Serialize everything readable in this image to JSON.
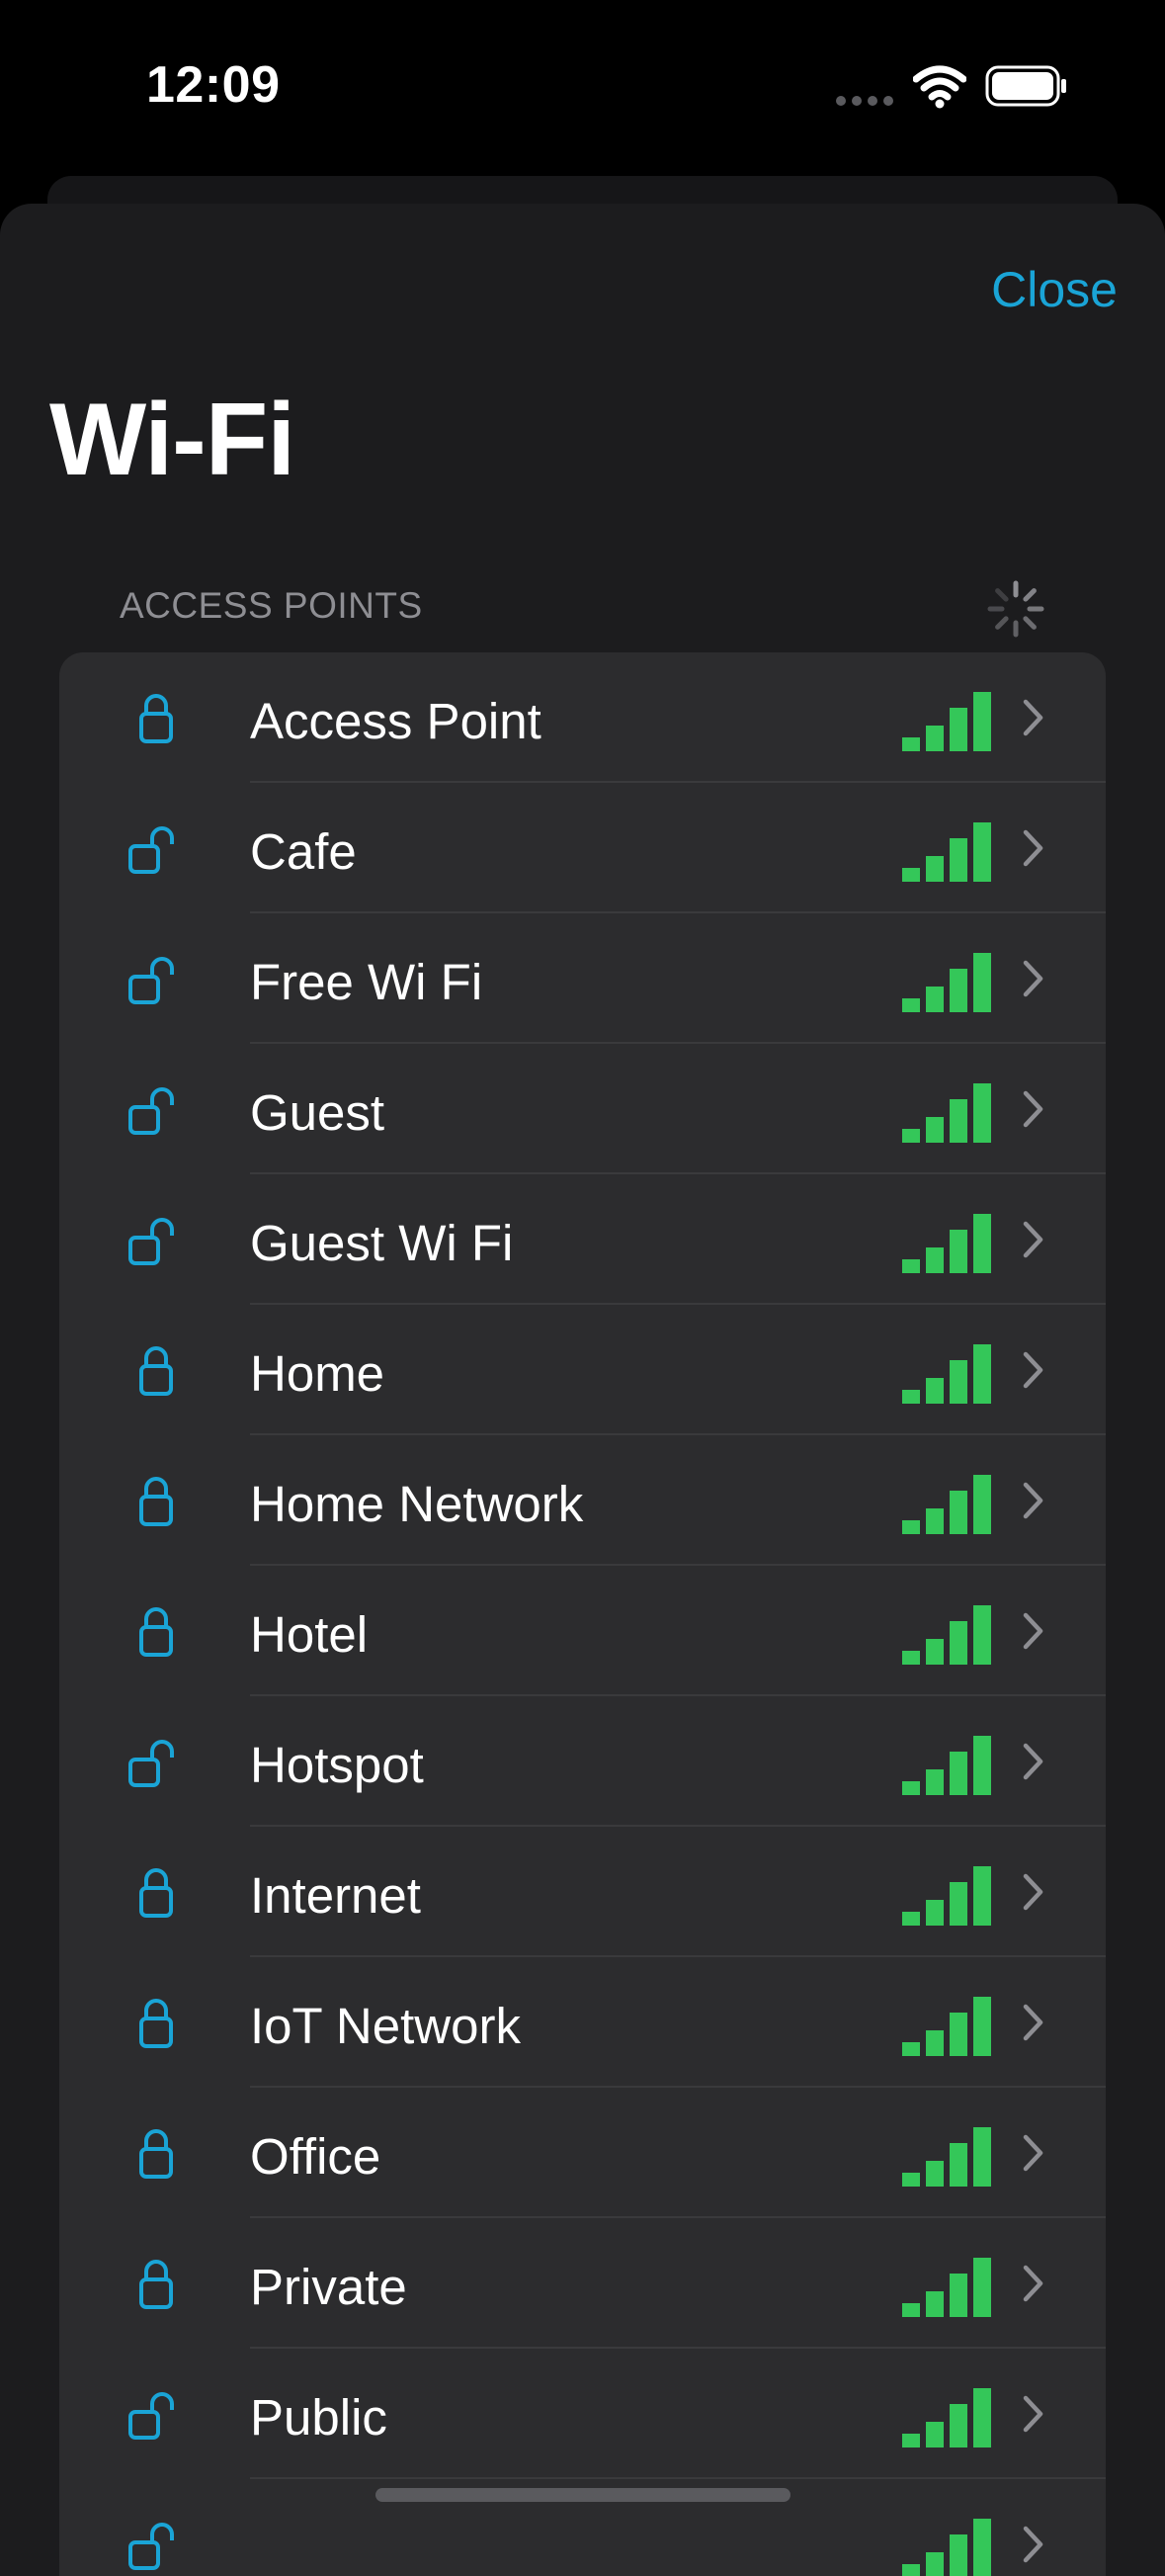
{
  "status_bar": {
    "time": "12:09",
    "icons": [
      "cellular-dots-icon",
      "wifi-icon",
      "battery-icon"
    ]
  },
  "sheet": {
    "close_label": "Close",
    "title": "Wi-Fi",
    "section_header": "ACCESS POINTS"
  },
  "colors": {
    "accent": "#1aa4d6",
    "signal": "#34c759",
    "chevron": "#8e8e93",
    "list_bg": "#2c2c2e",
    "sheet_bg": "#1c1c1e"
  },
  "access_points": [
    {
      "name": "Access Point",
      "secured": true,
      "signal": 4
    },
    {
      "name": "Cafe",
      "secured": false,
      "signal": 4
    },
    {
      "name": "Free Wi Fi",
      "secured": false,
      "signal": 4
    },
    {
      "name": "Guest",
      "secured": false,
      "signal": 4
    },
    {
      "name": "Guest Wi Fi",
      "secured": false,
      "signal": 4
    },
    {
      "name": "Home",
      "secured": true,
      "signal": 4
    },
    {
      "name": "Home Network",
      "secured": true,
      "signal": 4
    },
    {
      "name": "Hotel",
      "secured": true,
      "signal": 4
    },
    {
      "name": "Hotspot",
      "secured": false,
      "signal": 4
    },
    {
      "name": "Internet",
      "secured": true,
      "signal": 4
    },
    {
      "name": "IoT Network",
      "secured": true,
      "signal": 4
    },
    {
      "name": "Office",
      "secured": true,
      "signal": 4
    },
    {
      "name": "Private",
      "secured": true,
      "signal": 4
    },
    {
      "name": "Public",
      "secured": false,
      "signal": 4
    },
    {
      "name": "",
      "secured": false,
      "signal": 4
    }
  ]
}
